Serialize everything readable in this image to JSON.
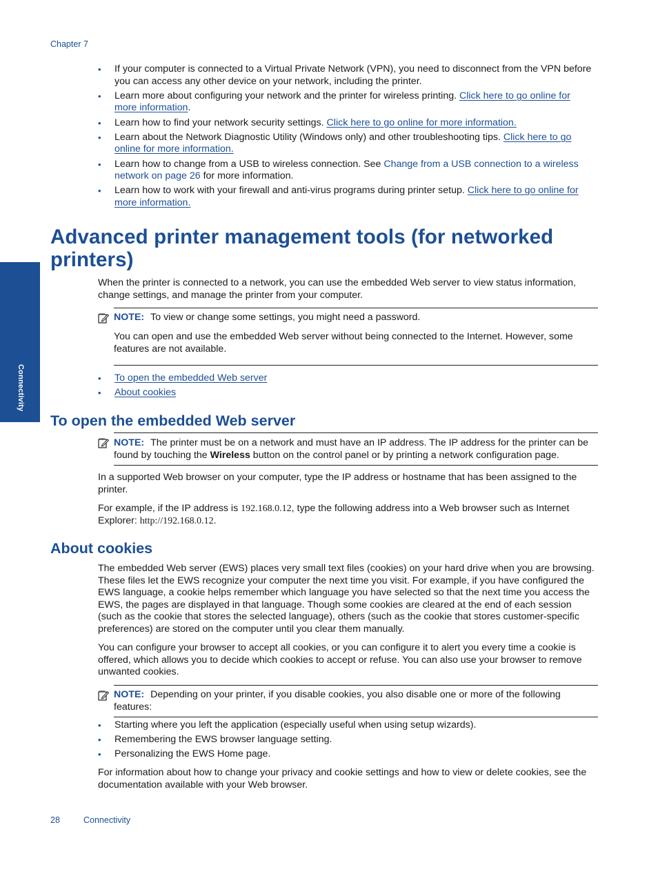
{
  "header": {
    "chapter": "Chapter 7"
  },
  "side_tab": {
    "label": "Connectivity"
  },
  "intro_bullets": [
    {
      "text": "If your computer is connected to a Virtual Private Network (VPN), you need to disconnect from the VPN before you can access any other device on your network, including the printer.",
      "link": "",
      "after": ""
    },
    {
      "text": "Learn more about configuring your network and the printer for wireless printing. ",
      "link": "Click here to go online for more information",
      "after": "."
    },
    {
      "text": "Learn how to find your network security settings. ",
      "link": "Click here to go online for more information.",
      "after": ""
    },
    {
      "text": "Learn about the Network Diagnostic Utility (Windows only) and other troubleshooting tips. ",
      "link": "Click here to go online for more information.",
      "after": ""
    },
    {
      "text": "Learn how to change from a USB to wireless connection. See ",
      "xref": "Change from a USB connection to a wireless network on page 26",
      "after": " for more information."
    },
    {
      "text": "Learn how to work with your firewall and anti-virus programs during printer setup. ",
      "link": "Click here to go online for more information.",
      "after": ""
    }
  ],
  "section_main": {
    "title": "Advanced printer management tools (for networked printers)",
    "paragraph": "When the printer is connected to a network, you can use the embedded Web server to view status information, change settings, and manage the printer from your computer.",
    "note": {
      "label": "NOTE:",
      "text": "To view or change some settings, you might need a password.",
      "extra": "You can open and use the embedded Web server without being connected to the Internet. However, some features are not available."
    },
    "toc_links": [
      "To open the embedded Web server",
      "About cookies"
    ]
  },
  "section_open_ews": {
    "title": "To open the embedded Web server",
    "note": {
      "label": "NOTE:",
      "text_before": "The printer must be on a network and must have an IP address. The IP address for the printer can be found by touching the ",
      "bold": "Wireless",
      "text_after": " button on the control panel or by printing a network configuration page."
    },
    "paragraph1": "In a supported Web browser on your computer, type the IP address or hostname that has been assigned to the printer.",
    "paragraph2_before": "For example, if the IP address is ",
    "ip": "192.168.0.12",
    "paragraph2_mid": ", type the following address into a Web browser such as Internet Explorer: ",
    "url": "http://192.168.0.12",
    "paragraph2_after": "."
  },
  "section_cookies": {
    "title": "About cookies",
    "paragraph1": "The embedded Web server (EWS) places very small text files (cookies) on your hard drive when you are browsing. These files let the EWS recognize your computer the next time you visit. For example, if you have configured the EWS language, a cookie helps remember which language you have selected so that the next time you access the EWS, the pages are displayed in that language. Though some cookies are cleared at the end of each session (such as the cookie that stores the selected language), others (such as the cookie that stores customer-specific preferences) are stored on the computer until you clear them manually.",
    "paragraph2": "You can configure your browser to accept all cookies, or you can configure it to alert you every time a cookie is offered, which allows you to decide which cookies to accept or refuse. You can also use your browser to remove unwanted cookies.",
    "note": {
      "label": "NOTE:",
      "text": "Depending on your printer, if you disable cookies, you also disable one or more of the following features:"
    },
    "features": [
      "Starting where you left the application (especially useful when using setup wizards).",
      "Remembering the EWS browser language setting.",
      "Personalizing the EWS Home page."
    ],
    "paragraph3": "For information about how to change your privacy and cookie settings and how to view or delete cookies, see the documentation available with your Web browser."
  },
  "footer": {
    "page_number": "28",
    "section": "Connectivity"
  },
  "icons": {
    "note": "note-pad-icon",
    "bullet": "•"
  },
  "colors": {
    "accent": "#1c4f94",
    "text": "#1a1a1a"
  }
}
